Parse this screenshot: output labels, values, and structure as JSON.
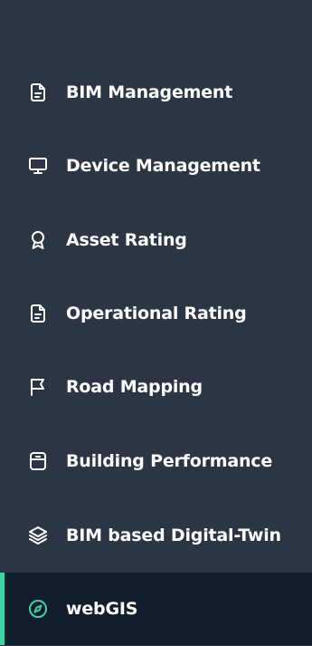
{
  "sidebar": {
    "items": [
      {
        "label": "BIM Management",
        "icon": "document-icon"
      },
      {
        "label": "Device Management",
        "icon": "monitor-icon"
      },
      {
        "label": "Asset Rating",
        "icon": "award-icon"
      },
      {
        "label": "Operational Rating",
        "icon": "document-icon"
      },
      {
        "label": "Road Mapping",
        "icon": "flag-icon"
      },
      {
        "label": "Building Performance",
        "icon": "archive-icon"
      },
      {
        "label": "BIM based Digital-Twin",
        "icon": "layers-icon"
      },
      {
        "label": "webGIS",
        "icon": "compass-icon",
        "active": true
      }
    ]
  },
  "colors": {
    "background": "#2b3544",
    "active_background": "#141d2b",
    "accent": "#3ed3a7",
    "text": "#ffffff"
  }
}
